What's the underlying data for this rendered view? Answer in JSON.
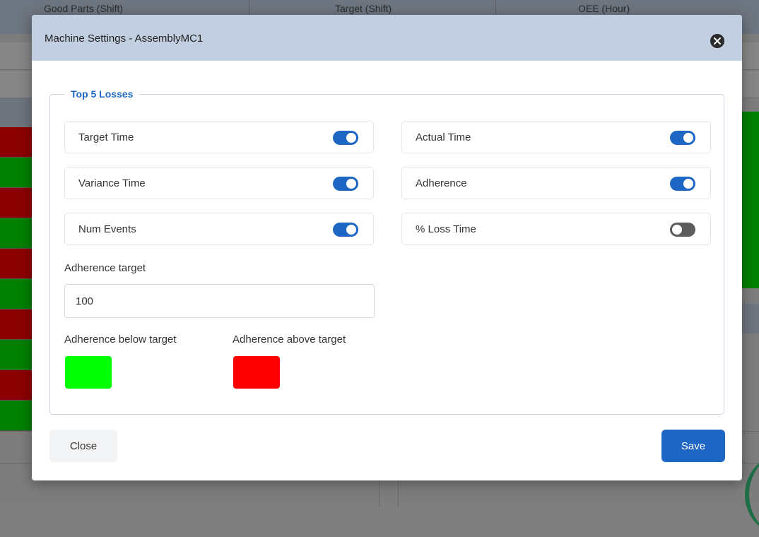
{
  "background": {
    "header_cells": [
      "Good Parts (Shift)",
      "Target (Shift)",
      "OEE (Hour)"
    ],
    "strip_colors": [
      "#8b0000",
      "#008000",
      "#8b0000",
      "#008000",
      "#8b0000",
      "#008000",
      "#8b0000",
      "#008000",
      "#8b0000",
      "#008000"
    ]
  },
  "modal": {
    "title": "Machine Settings - AssemblyMC1",
    "close_icon": "close-circle-icon",
    "section_legend": "Top 5 Losses",
    "toggles": [
      {
        "label": "Target Time",
        "on": true
      },
      {
        "label": "Actual Time",
        "on": true
      },
      {
        "label": "Variance Time",
        "on": true
      },
      {
        "label": "Adherence",
        "on": true
      },
      {
        "label": "Num Events",
        "on": true
      },
      {
        "label": "% Loss Time",
        "on": false
      }
    ],
    "adherence_target": {
      "label": "Adherence target",
      "value": "100"
    },
    "below_target": {
      "label": "Adherence below target",
      "color": "#00ff00"
    },
    "above_target": {
      "label": "Adherence above target",
      "color": "#ff0000"
    },
    "close_label": "Close",
    "save_label": "Save"
  },
  "colors": {
    "accent": "#1d66c4",
    "header_bg": "#c2cfe1",
    "legend": "#1f66c1"
  }
}
